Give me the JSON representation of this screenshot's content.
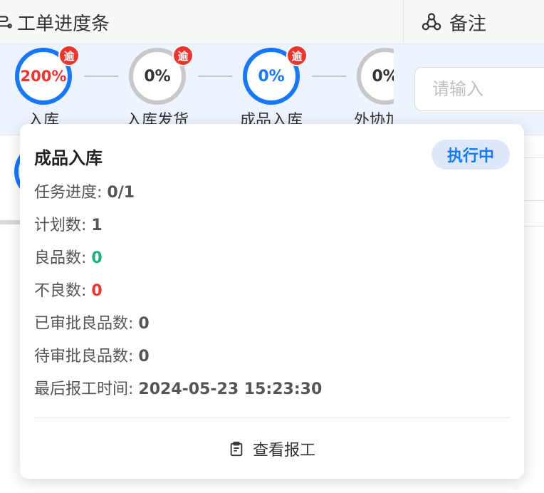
{
  "header": {
    "progress_col": "工单进度条",
    "remark_col": "备注"
  },
  "row1": {
    "steps": [
      {
        "percent": "200%",
        "label": "入库",
        "overdue_badge": "逾"
      },
      {
        "percent": "0%",
        "label": "入库发货",
        "overdue_badge": "逾"
      },
      {
        "percent": "0%",
        "label": "成品入库",
        "overdue_badge": "逾"
      },
      {
        "percent": "0%",
        "label": "外协加工"
      }
    ],
    "remark_placeholder": "请输入"
  },
  "popover": {
    "title": "成品入库",
    "status": "执行中",
    "task_progress_label": "任务进度:",
    "task_progress_value": "0/1",
    "planned_label": "计划数:",
    "planned_value": "1",
    "good_label": "良品数:",
    "good_value": "0",
    "defect_label": "不良数:",
    "defect_value": "0",
    "approved_good_label": "已审批良品数:",
    "approved_good_value": "0",
    "pending_good_label": "待审批良品数:",
    "pending_good_value": "0",
    "last_report_label": "最后报工时间:",
    "last_report_value": "2024-05-23 15:23:30",
    "action_label": "查看报工"
  },
  "colors": {
    "primary": "#1677ff",
    "danger": "#f5312c",
    "success": "#16b47a",
    "row_highlight": "#edf4ff"
  }
}
